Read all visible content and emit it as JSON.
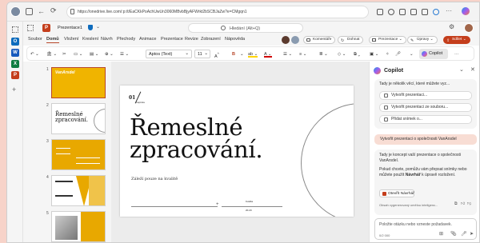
{
  "browser": {
    "url": "https://onedrive.live.com/:p:/t/EaCKkPoAchUwUn3060MBvbBjyAFWrkt2bSCBJaZw?e=CMgqn1"
  },
  "app": {
    "doc_title": "Prezentace1",
    "search_placeholder": "Hledání (Alt+Q)",
    "comments_label": "Komentáře",
    "catchup_label": "Dohnat",
    "present_label": "Prezentace",
    "edit_label": "Úpravy",
    "share_label": "Sdílet"
  },
  "tabs": [
    "Soubor",
    "Domů",
    "Vložení",
    "Kreslení",
    "Návrh",
    "Přechody",
    "Animace",
    "Prezentace",
    "Revize",
    "Zobrazení",
    "Nápověda"
  ],
  "ribbon": {
    "font_name": "Aptos (Text)",
    "font_size": "11",
    "copilot_label": "Copilot"
  },
  "thumbnails": [
    {
      "num": "1",
      "brand": "VanArsdel"
    },
    {
      "num": "2",
      "title": "Řemeslné zpracování."
    },
    {
      "num": "3"
    },
    {
      "num": "4"
    },
    {
      "num": "5"
    }
  ],
  "slide": {
    "number": "01",
    "section": "Kapitola",
    "title_line1": "Řemeslné",
    "title_line2": "zpracování.",
    "subtitle": "Záleží pouze na kvalitě",
    "footer_a": "Kvalita",
    "footer_b": "20.20"
  },
  "copilot": {
    "header": "Copilot",
    "intro": "Tady je několik věcí, které můžete vyz...",
    "actions": [
      "Vytvořit prezentaci...",
      "Vytvořit prezentaci ze souboru...",
      "Přidat snímek o..."
    ],
    "user_msg": "Vytvořit prezentaci o společnosti VanArsdel",
    "reply1": "Tady je koncept vaší prezentace o společnosti VanArsdel.",
    "reply2": "Pokud chcete, pomůžu vám přepsat snímky nebo můžete použít",
    "reply_bold": "Návrhář",
    "reply3": "k úpravě rozložení.",
    "open_designer": "Otevřít Návrhář",
    "disclaimer": "Obsah vygenerovaný umělou inteligenc...",
    "input_placeholder": "Položte otázku nebo vzneste požadavek.",
    "counter": "0/2 000"
  },
  "colors": {
    "accent": "#b7472a",
    "yellow": "#e8a800",
    "copilot_msg": "#f8ddd4"
  }
}
